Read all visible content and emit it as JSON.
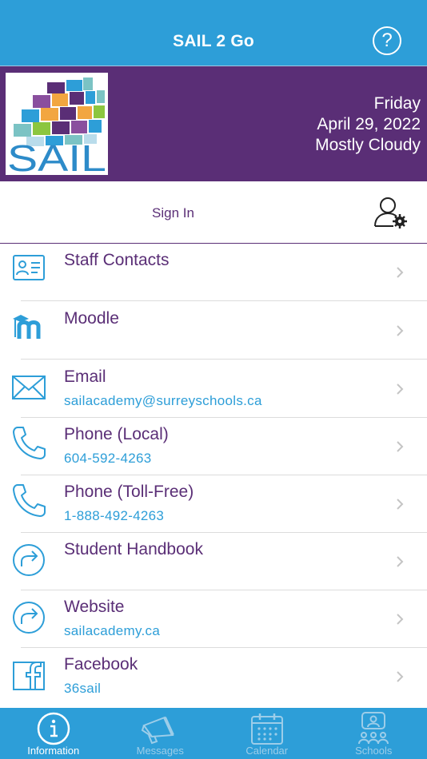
{
  "header": {
    "title": "SAIL 2 Go",
    "help_glyph": "?"
  },
  "banner": {
    "logo_text": "SAIL",
    "day": "Friday",
    "date": "April 29, 2022",
    "weather": "Mostly Cloudy"
  },
  "signin": {
    "label": "Sign In",
    "icon": "user-settings-icon"
  },
  "items": [
    {
      "title": "Staff Contacts",
      "subtitle": "",
      "icon": "contact-card-icon"
    },
    {
      "title": "Moodle",
      "subtitle": "",
      "icon": "moodle-icon"
    },
    {
      "title": "Email",
      "subtitle": "sailacademy@surreyschools.ca",
      "icon": "envelope-icon"
    },
    {
      "title": "Phone (Local)",
      "subtitle": "604-592-4263",
      "icon": "phone-icon"
    },
    {
      "title": "Phone (Toll-Free)",
      "subtitle": "1-888-492-4263",
      "icon": "phone-icon"
    },
    {
      "title": "Student Handbook",
      "subtitle": "",
      "icon": "share-arrow-icon"
    },
    {
      "title": "Website",
      "subtitle": "sailacademy.ca",
      "icon": "share-arrow-icon"
    },
    {
      "title": "Facebook",
      "subtitle": "36sail",
      "icon": "facebook-icon"
    }
  ],
  "tabs": [
    {
      "label": "Information",
      "icon": "info-icon",
      "active": true
    },
    {
      "label": "Messages",
      "icon": "megaphone-icon",
      "active": false
    },
    {
      "label": "Calendar",
      "icon": "calendar-icon",
      "active": false
    },
    {
      "label": "Schools",
      "icon": "schools-icon",
      "active": false
    }
  ],
  "colors": {
    "primary_blue": "#2d9ed8",
    "brand_purple": "#5a2e76",
    "inactive_tab": "#9ccde9"
  }
}
